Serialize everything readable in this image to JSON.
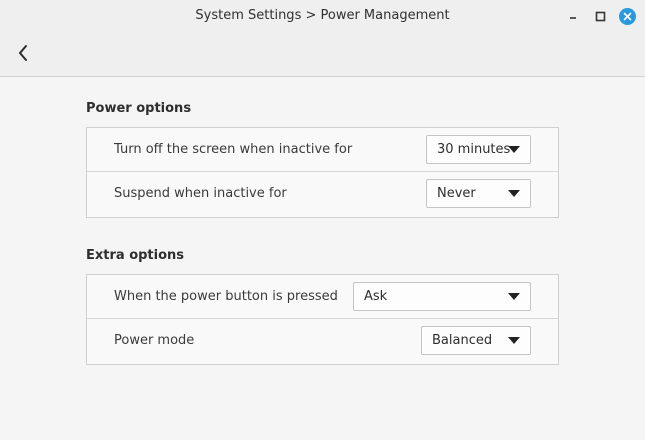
{
  "window": {
    "title": "System Settings > Power Management"
  },
  "icons": {
    "back": "chevron-left-icon",
    "minimize": "minimize-icon",
    "maximize": "maximize-icon",
    "close": "close-icon"
  },
  "colors": {
    "accent": "#2a9adf"
  },
  "power_options": {
    "title": "Power options",
    "rows": [
      {
        "label": "Turn off the screen when inactive for",
        "value": "30 minutes"
      },
      {
        "label": "Suspend when inactive for",
        "value": "Never"
      }
    ]
  },
  "extra_options": {
    "title": "Extra options",
    "rows": [
      {
        "label": "When the power button is pressed",
        "value": "Ask"
      },
      {
        "label": "Power mode",
        "value": "Balanced"
      }
    ]
  }
}
